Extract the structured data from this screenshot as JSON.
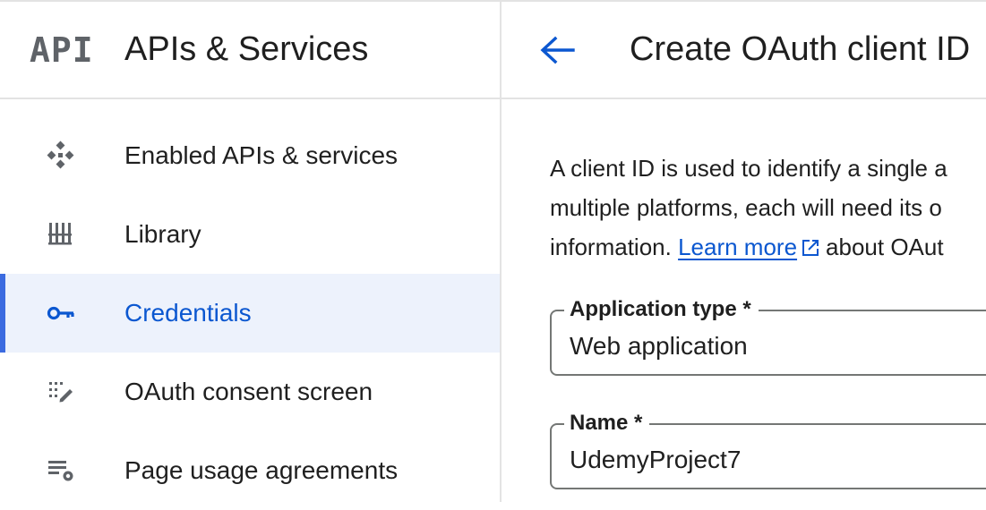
{
  "sidebar": {
    "logo_text": "API",
    "title": "APIs & Services",
    "items": [
      {
        "label": "Enabled APIs & services",
        "icon": "enabled-apis-icon",
        "active": false
      },
      {
        "label": "Library",
        "icon": "library-icon",
        "active": false
      },
      {
        "label": "Credentials",
        "icon": "key-icon",
        "active": true
      },
      {
        "label": "OAuth consent screen",
        "icon": "consent-screen-icon",
        "active": false
      },
      {
        "label": "Page usage agreements",
        "icon": "settings-list-icon",
        "active": false
      }
    ]
  },
  "main": {
    "title": "Create OAuth client ID",
    "description": {
      "line1": "A client ID is used to identify a single a",
      "line2": "multiple platforms, each will need its o",
      "line3_before": "information.",
      "link": "Learn more",
      "line3_after": "about OAut"
    },
    "application_type": {
      "label": "Application type *",
      "value": "Web application"
    },
    "name": {
      "label": "Name *",
      "value": "UdemyProject7"
    }
  },
  "colors": {
    "accent": "#0b57d0",
    "active_bg": "#edf2fc",
    "active_bar": "#3b6be0",
    "divider": "#e3e3e3",
    "icon_gray": "#5f6368"
  }
}
